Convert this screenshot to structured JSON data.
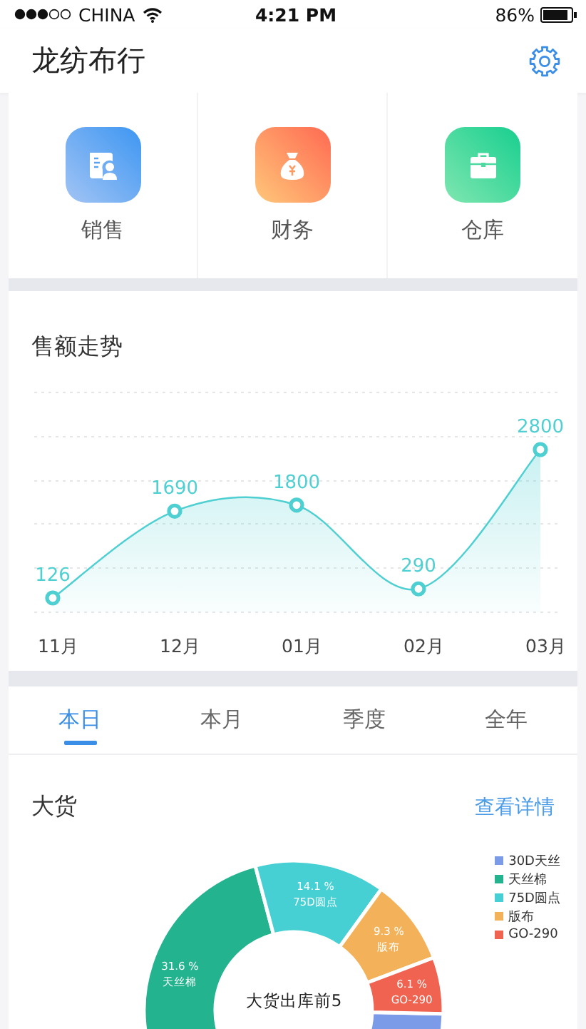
{
  "status_bar": {
    "carrier": "CHINA",
    "time": "4:21 PM",
    "battery": "86%"
  },
  "header": {
    "title": "龙纺布行"
  },
  "shortcuts": [
    {
      "label": "销售",
      "kind": "sales"
    },
    {
      "label": "财务",
      "kind": "finance"
    },
    {
      "label": "仓库",
      "kind": "warehouse"
    }
  ],
  "sales_trend": {
    "title": "售额走势",
    "chart_data": {
      "type": "area",
      "categories": [
        "11月",
        "12月",
        "01月",
        "02月",
        "03月"
      ],
      "series": [
        {
          "color": "#4ecfd1",
          "values": [
            126,
            1690,
            1800,
            290,
            2800
          ]
        }
      ],
      "data_labels": true
    }
  },
  "period_tabs": [
    {
      "label": "本日",
      "selected": true
    },
    {
      "label": "本月",
      "selected": false
    },
    {
      "label": "季度",
      "selected": false
    },
    {
      "label": "全年",
      "selected": false
    }
  ],
  "bulk_goods": {
    "title": "大货",
    "link": "查看详情",
    "chart_data": {
      "type": "donut",
      "title": "大货出库前5",
      "categories": [
        "30D天丝",
        "天丝棉",
        "75D圆点",
        "版布",
        "GO-290"
      ],
      "values": [
        38.9,
        31.6,
        14.1,
        9.3,
        6.1
      ],
      "colors": [
        "#7b9be8",
        "#23b48f",
        "#46d0d3",
        "#f3b259",
        "#ef6350"
      ],
      "value_labels": [
        null,
        "31.6 %",
        "14.1 %",
        "9.3 %",
        "6.1 %"
      ]
    }
  }
}
